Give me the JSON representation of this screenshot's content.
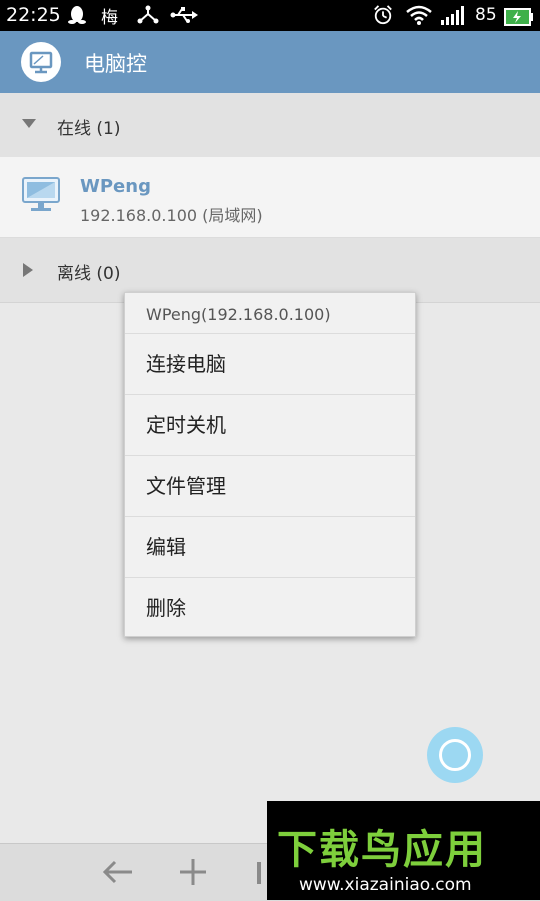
{
  "status_bar": {
    "time": "22:25",
    "plum_char": "梅",
    "battery": "85",
    "icons": [
      "qq-icon",
      "plum-icon",
      "share-network-icon",
      "usb-icon",
      "alarm-clock-icon",
      "wifi-icon",
      "signal-icon",
      "battery-icon"
    ]
  },
  "app_bar": {
    "title": "电脑控",
    "logo_icon": "computer-monitor-icon"
  },
  "groups": {
    "online": {
      "label": "在线 (1)",
      "expanded": true
    },
    "offline": {
      "label": "离线 (0)",
      "expanded": false
    }
  },
  "devices": [
    {
      "name": "WPeng",
      "ip": "192.168.0.100 (局域网)",
      "icon": "computer-monitor-icon"
    }
  ],
  "context_menu": {
    "header": "WPeng(192.168.0.100)",
    "items": [
      "连接电脑",
      "定时关机",
      "文件管理",
      "编辑",
      "删除"
    ]
  },
  "bottom_bar": {
    "icons": [
      "back-arrow-icon",
      "add-icon",
      "menu-icon"
    ]
  },
  "watermark": {
    "title": "下载鸟应用",
    "url": "www.xiazainiao.com"
  },
  "colors": {
    "accent": "#6a97c0",
    "fab": "#9cd8f2",
    "watermark_green": "#7ecf3c"
  }
}
